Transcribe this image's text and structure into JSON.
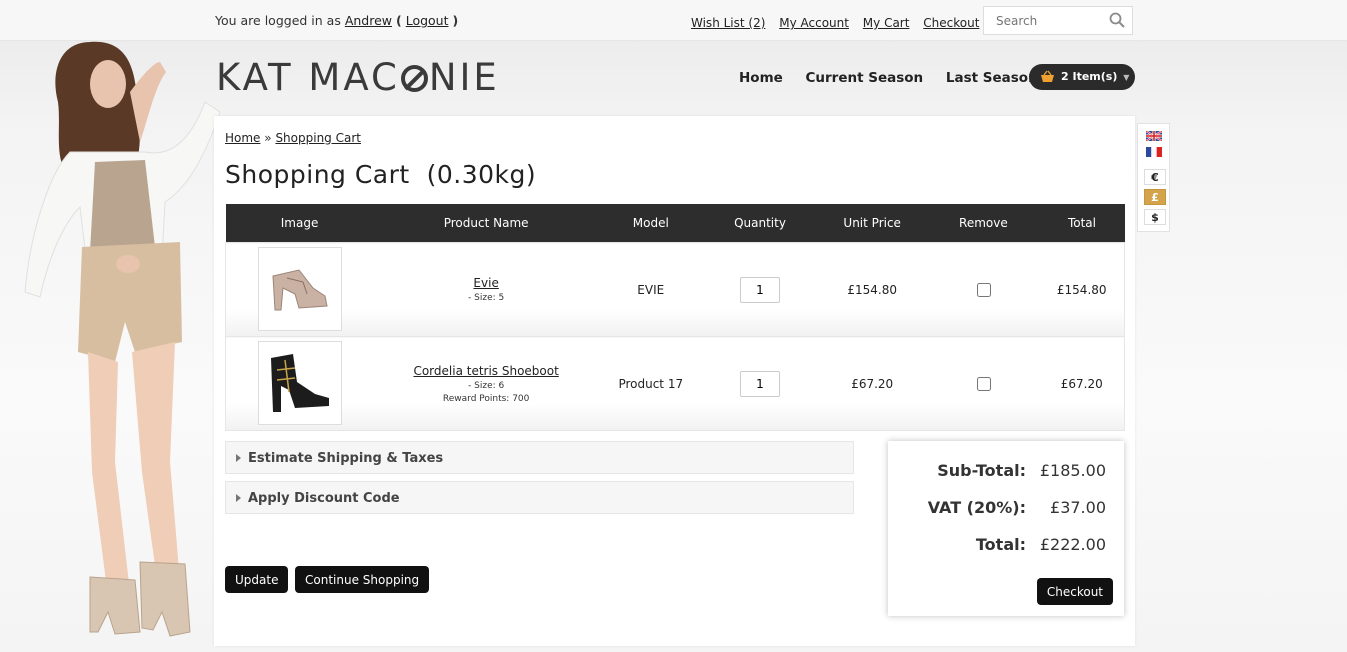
{
  "topbar": {
    "login_prefix": "You are logged in as",
    "user": "Andrew",
    "open_paren": "(",
    "logout": "Logout",
    "close_paren": ")",
    "links": [
      "Wish List (2)",
      "My Account",
      "My Cart",
      "Checkout"
    ],
    "search_placeholder": "Search"
  },
  "header": {
    "logo_part1": "KAT MAC",
    "logo_part2": "NIE",
    "nav": [
      "Home",
      "Current Season",
      "Last Season"
    ],
    "cart_label": "2 Item(s)"
  },
  "currency": {
    "symbols": [
      "€",
      "£",
      "$"
    ],
    "active": "£"
  },
  "breadcrumb": {
    "home": "Home",
    "separator": "»",
    "current": "Shopping Cart"
  },
  "page": {
    "title": "Shopping Cart  (0.30kg)"
  },
  "table": {
    "headers": [
      "Image",
      "Product Name",
      "Model",
      "Quantity",
      "Unit Price",
      "Remove",
      "Total"
    ],
    "rows": [
      {
        "name": "Evie",
        "options": [
          "- Size: 5"
        ],
        "model": "EVIE",
        "quantity": "1",
        "unit_price": "£154.80",
        "total": "£154.80"
      },
      {
        "name": "Cordelia tetris Shoeboot",
        "options": [
          "- Size: 6",
          "Reward Points: 700"
        ],
        "model": "Product 17",
        "quantity": "1",
        "unit_price": "£67.20",
        "total": "£67.20"
      }
    ]
  },
  "accordions": {
    "shipping": "Estimate Shipping & Taxes",
    "discount": "Apply Discount Code"
  },
  "buttons": {
    "update": "Update",
    "continue": "Continue Shopping",
    "checkout": "Checkout"
  },
  "totals": {
    "subtotal_label": "Sub-Total:",
    "subtotal": "£185.00",
    "vat_label": "VAT (20%):",
    "vat": "£37.00",
    "total_label": "Total:",
    "total": "£222.00"
  }
}
